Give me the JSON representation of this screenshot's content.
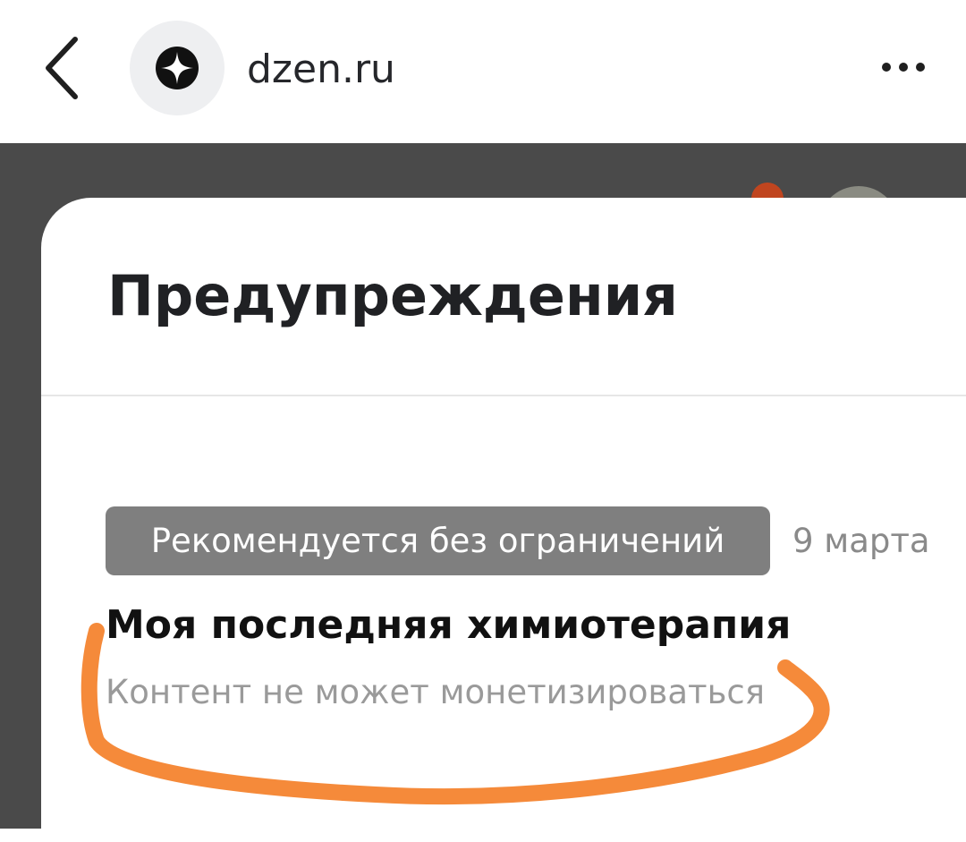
{
  "browser": {
    "site_name": "dzen.ru",
    "back_icon": "chevron-left-icon",
    "site_icon": "dzen-logo-icon",
    "more_icon": "more-horizontal-icon"
  },
  "sheet": {
    "title": "Предупреждения",
    "item": {
      "status": "Рекомендуется без ограничений",
      "date": "9 марта",
      "title": "Моя последняя химиотерапия",
      "subtitle": "Контент не может монетизироваться"
    }
  },
  "colors": {
    "overlay": "#4a4a4a",
    "badge_bg": "#7f7f7f",
    "annotation_stroke": "#f58a3a"
  }
}
